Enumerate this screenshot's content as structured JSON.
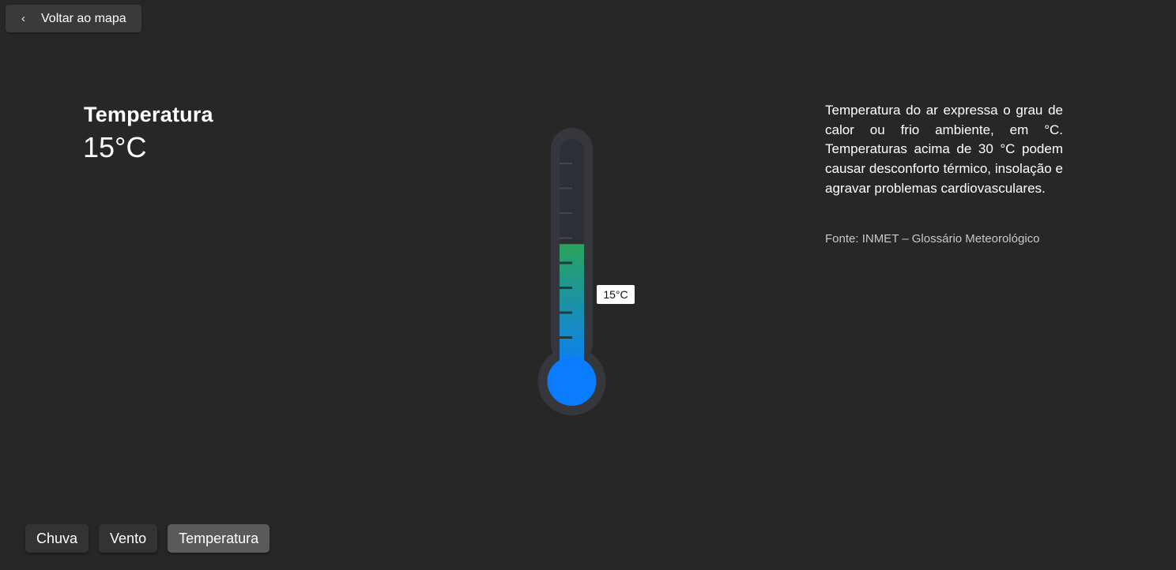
{
  "back_button": {
    "label": "Voltar ao mapa",
    "icon": "chevron-left-icon"
  },
  "metric": {
    "title": "Temperatura",
    "value": "15°C"
  },
  "thermometer": {
    "value_label": "15°C",
    "fill_fraction": 0.4,
    "colors": {
      "fill_top": "#2aa35a",
      "fill_bottom": "#0a7dff",
      "bulb": "#0a7dff",
      "tube": "#36373d",
      "track": "#2e2f35"
    }
  },
  "description": {
    "text": "Temperatura do ar expressa o grau de calor ou frio ambiente, em °C. Temperaturas acima de 30 °C podem causar desconforto térmico, insolação e agravar problemas cardiovasculares.",
    "source": "Fonte: INMET – Glossário Meteorológico"
  },
  "tabs": [
    {
      "label": "Chuva",
      "active": false
    },
    {
      "label": "Vento",
      "active": false
    },
    {
      "label": "Temperatura",
      "active": true
    }
  ]
}
